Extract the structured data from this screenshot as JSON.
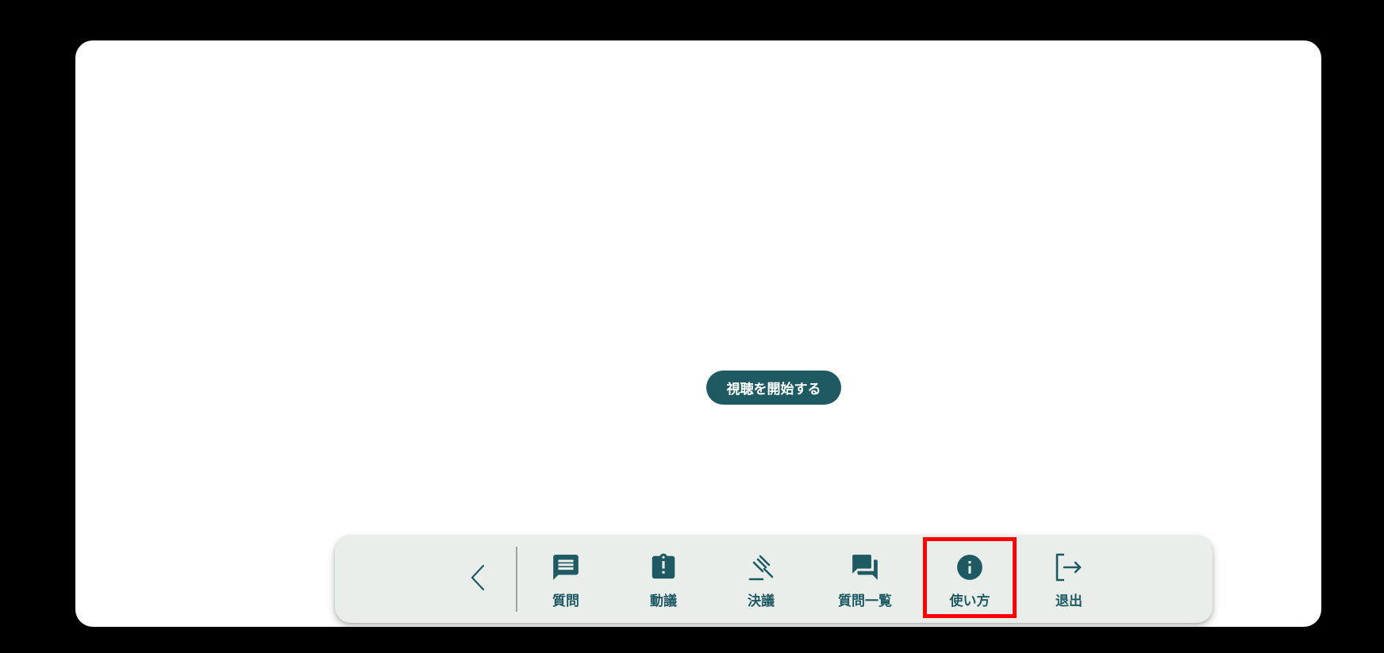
{
  "main": {
    "start_button_label": "視聴を開始する"
  },
  "toolbar": {
    "collapse_icon": "chevron-left-icon",
    "items": [
      {
        "label": "質問",
        "icon": "comment-icon"
      },
      {
        "label": "動議",
        "icon": "clipboard-alert-icon"
      },
      {
        "label": "決議",
        "icon": "gavel-icon"
      },
      {
        "label": "質問一覧",
        "icon": "forum-icon"
      },
      {
        "label": "使い方",
        "icon": "info-icon"
      },
      {
        "label": "退出",
        "icon": "logout-icon"
      }
    ],
    "highlighted_item": "使い方"
  },
  "colors": {
    "accent": "#1f5a63",
    "toolbar_bg": "#e9eeeb",
    "highlight": "#ff0000",
    "background": "#000000",
    "card": "#ffffff"
  }
}
